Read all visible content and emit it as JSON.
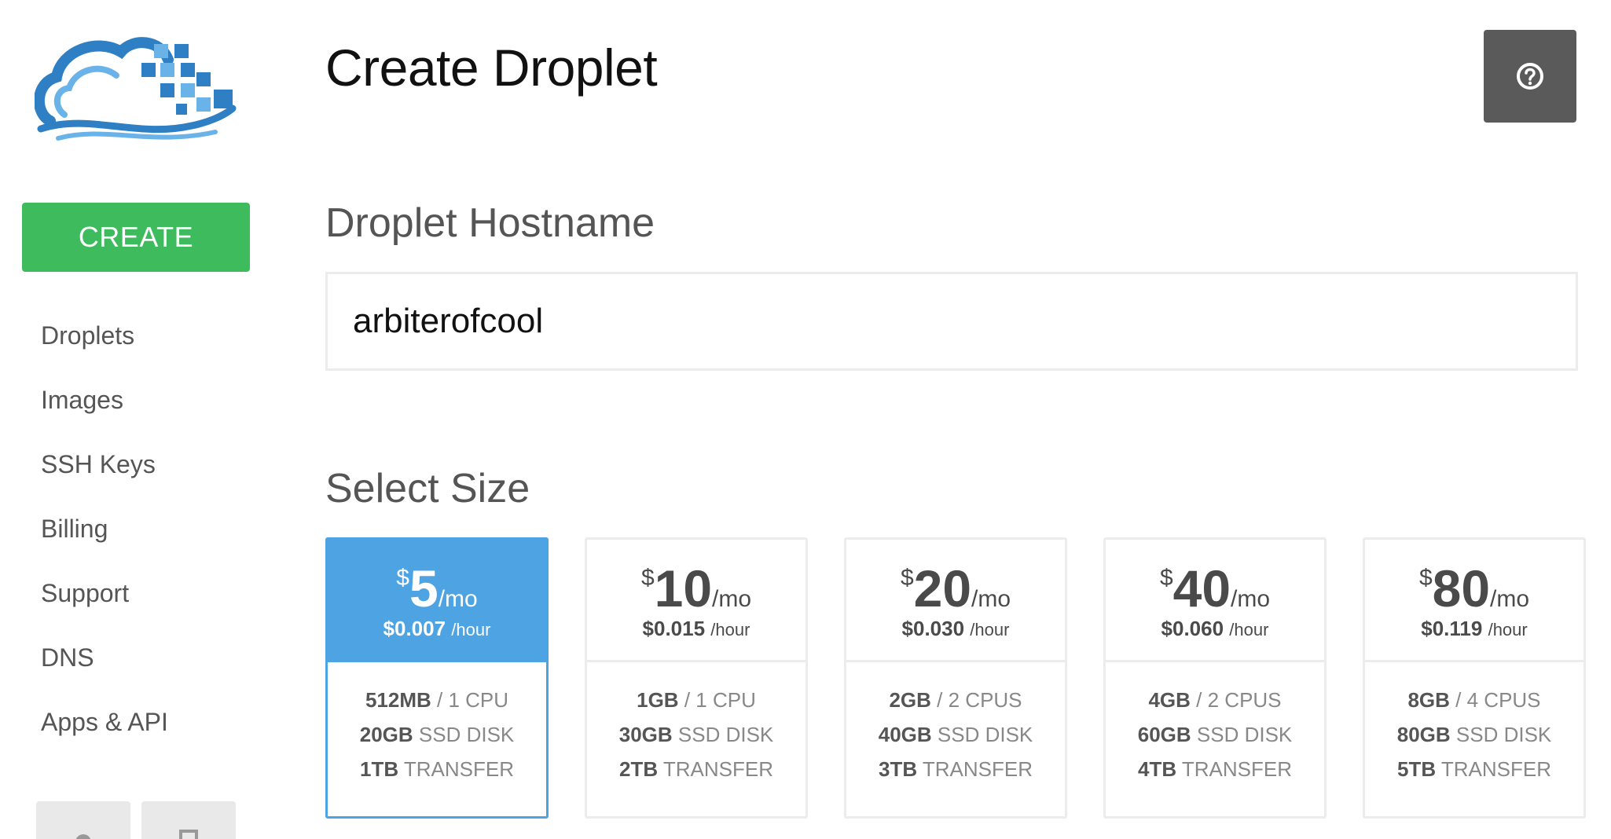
{
  "sidebar": {
    "create_label": "CREATE",
    "items": [
      {
        "label": "Droplets"
      },
      {
        "label": "Images"
      },
      {
        "label": "SSH Keys"
      },
      {
        "label": "Billing"
      },
      {
        "label": "Support"
      },
      {
        "label": "DNS"
      },
      {
        "label": "Apps & API"
      }
    ],
    "bottom_icons": [
      "gear-icon",
      "logout-icon"
    ]
  },
  "header": {
    "title": "Create Droplet",
    "help_icon": "question-circle-icon"
  },
  "hostname": {
    "label": "Droplet Hostname",
    "value": "arbiterofcool"
  },
  "size": {
    "label": "Select Size",
    "plans": [
      {
        "currency": "$",
        "amount": "5",
        "per": "/mo",
        "hourly": "$0.007",
        "hourly_unit": "/hour",
        "ram": "512MB",
        "cpu": "/ 1 CPU",
        "disk": "20GB",
        "disk_suffix": "SSD DISK",
        "transfer": "1TB",
        "transfer_suffix": "TRANSFER",
        "selected": true
      },
      {
        "currency": "$",
        "amount": "10",
        "per": "/mo",
        "hourly": "$0.015",
        "hourly_unit": "/hour",
        "ram": "1GB",
        "cpu": "/ 1 CPU",
        "disk": "30GB",
        "disk_suffix": "SSD DISK",
        "transfer": "2TB",
        "transfer_suffix": "TRANSFER",
        "selected": false
      },
      {
        "currency": "$",
        "amount": "20",
        "per": "/mo",
        "hourly": "$0.030",
        "hourly_unit": "/hour",
        "ram": "2GB",
        "cpu": "/ 2 CPUS",
        "disk": "40GB",
        "disk_suffix": "SSD DISK",
        "transfer": "3TB",
        "transfer_suffix": "TRANSFER",
        "selected": false
      },
      {
        "currency": "$",
        "amount": "40",
        "per": "/mo",
        "hourly": "$0.060",
        "hourly_unit": "/hour",
        "ram": "4GB",
        "cpu": "/ 2 CPUS",
        "disk": "60GB",
        "disk_suffix": "SSD DISK",
        "transfer": "4TB",
        "transfer_suffix": "TRANSFER",
        "selected": false
      },
      {
        "currency": "$",
        "amount": "80",
        "per": "/mo",
        "hourly": "$0.119",
        "hourly_unit": "/hour",
        "ram": "8GB",
        "cpu": "/ 4 CPUS",
        "disk": "80GB",
        "disk_suffix": "SSD DISK",
        "transfer": "5TB",
        "transfer_suffix": "TRANSFER",
        "selected": false
      }
    ]
  },
  "colors": {
    "accent_blue": "#4ea3e3",
    "create_green": "#3ebc5d",
    "help_button": "#5a5a5a"
  }
}
